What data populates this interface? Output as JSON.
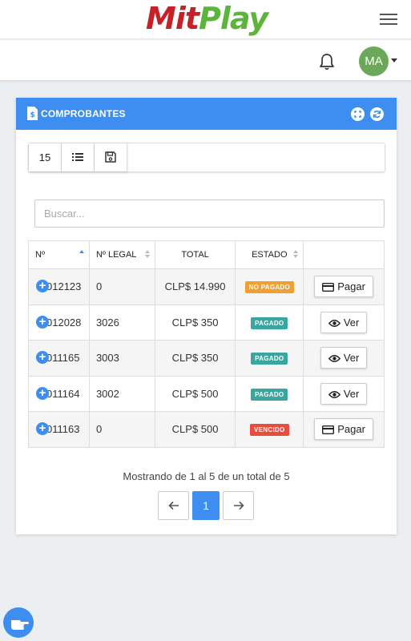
{
  "header": {
    "logo_left": "Mit",
    "logo_right": "Play"
  },
  "user": {
    "initials": "MA"
  },
  "card": {
    "title": "COMPROBANTES",
    "page_size": "15",
    "search_placeholder": "Buscar...",
    "columns": [
      "Nº",
      "Nº LEGAL",
      "TOTAL",
      "ESTADO",
      ""
    ],
    "rows": [
      {
        "numero": "012123",
        "legal": "0",
        "total": "CLP$ 14.990",
        "estado": "NO PAGADO",
        "estado_color": "#f0a030",
        "accion": "Pagar",
        "accion_icon": "card-icon"
      },
      {
        "numero": "012028",
        "legal": "3026",
        "total": "CLP$ 350",
        "estado": "PAGADO",
        "estado_color": "#3aa6a0",
        "accion": "Ver",
        "accion_icon": "eye-icon"
      },
      {
        "numero": "011165",
        "legal": "3003",
        "total": "CLP$ 350",
        "estado": "PAGADO",
        "estado_color": "#3aa6a0",
        "accion": "Ver",
        "accion_icon": "eye-icon"
      },
      {
        "numero": "011164",
        "legal": "3002",
        "total": "CLP$ 500",
        "estado": "PAGADO",
        "estado_color": "#3aa6a0",
        "accion": "Ver",
        "accion_icon": "eye-icon"
      },
      {
        "numero": "011163",
        "legal": "0",
        "total": "CLP$ 500",
        "estado": "VENCIDO",
        "estado_color": "#e74c3c",
        "accion": "Pagar",
        "accion_icon": "card-icon"
      }
    ],
    "info": "Mostrando de 1 al 5 de un total de 5",
    "current_page": "1"
  },
  "colors": {
    "accent": "#3d8ef0",
    "avatar": "#6ba85a"
  }
}
